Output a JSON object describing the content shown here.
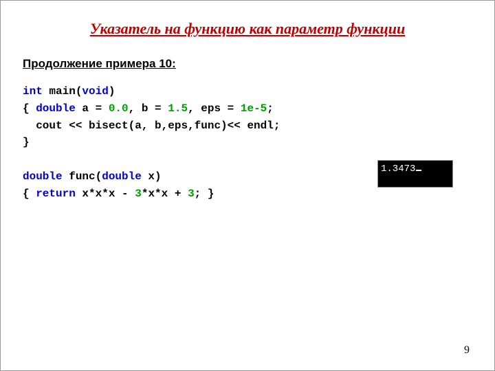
{
  "title": "Указатель на функцию как параметр функции",
  "subtitle": "Продолжение примера 10:",
  "code": {
    "l1_kw_int": "int",
    "l1_rest1": " main(",
    "l1_kw_void": "void",
    "l1_rest2": ")",
    "l2_a": "{ ",
    "l2_kw_double": "double",
    "l2_b": " a = ",
    "l2_n1": "0.0",
    "l2_c": ", b = ",
    "l2_n2": "1.5",
    "l2_d": ", eps = ",
    "l2_n3": "1e-5",
    "l2_e": ";",
    "l3": "  cout << bisect(a, b,eps,func)<< endl;",
    "l4": "}",
    "l5_kw_double": "double",
    "l5_a": " func(",
    "l5_kw_double2": "double",
    "l5_b": " x)",
    "l6_a": "{ ",
    "l6_kw_return": "return",
    "l6_b": " x*x*x - ",
    "l6_n1": "3",
    "l6_c": "*x*x + ",
    "l6_n2": "3",
    "l6_d": "; }"
  },
  "console_output": "1.3473",
  "page_number": "9"
}
